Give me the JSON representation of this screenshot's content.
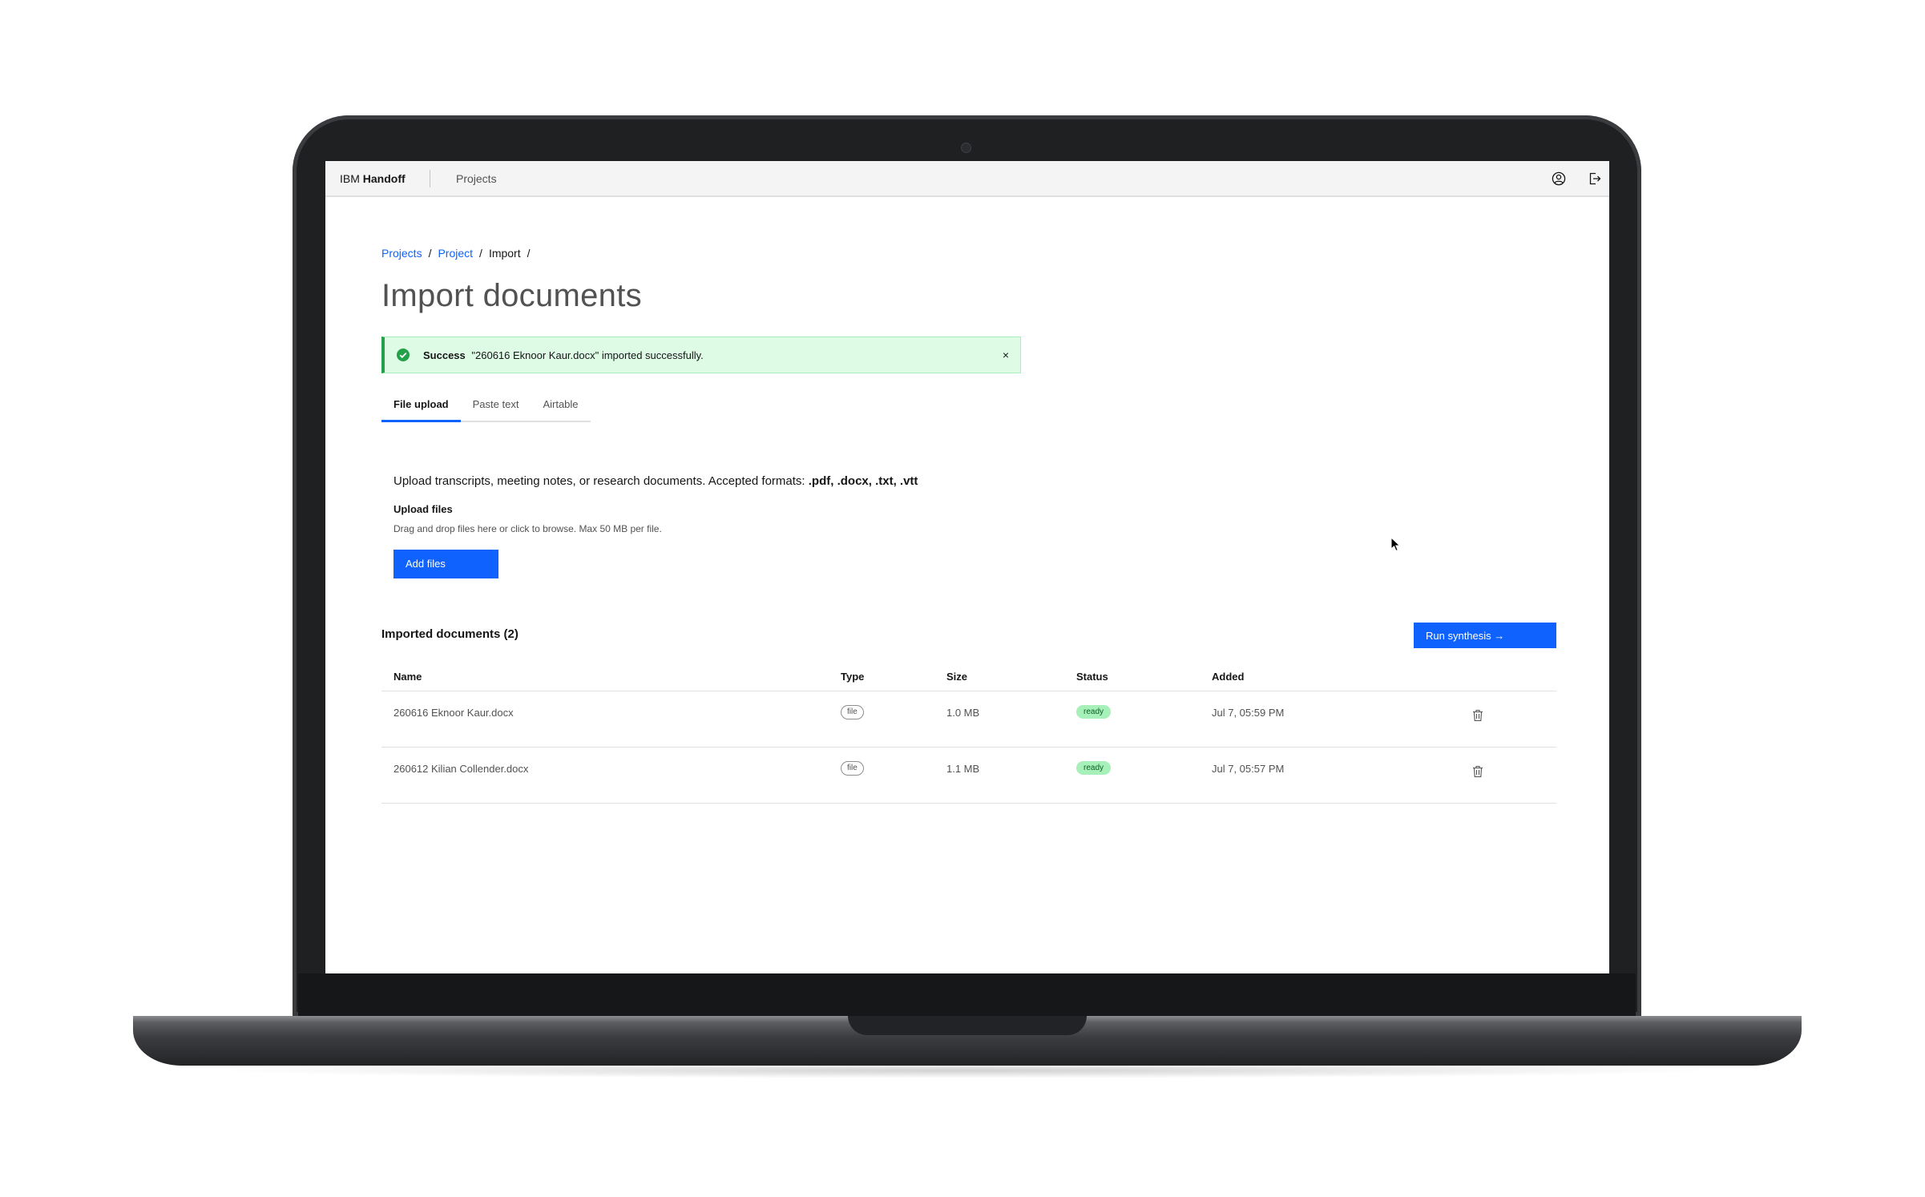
{
  "app": {
    "brand_prefix": "IBM",
    "brand_name": "Handoff",
    "nav_projects": "Projects"
  },
  "icons": {
    "user": "user-avatar-icon",
    "logout": "logout-icon",
    "success": "checkmark-filled-icon",
    "close": "close-icon",
    "delete": "trash-icon",
    "cursor": "mouse-pointer-icon"
  },
  "breadcrumb": {
    "items": [
      "Projects",
      "Project",
      "Import"
    ],
    "separator": "/"
  },
  "page": {
    "title": "Import documents"
  },
  "notification": {
    "kind": "success",
    "title": "Success",
    "message": "\"260616 Eknoor Kaur.docx\" imported successfully.",
    "close_glyph": "×"
  },
  "tabs": [
    {
      "label": "File upload",
      "active": true
    },
    {
      "label": "Paste text",
      "active": false
    },
    {
      "label": "Airtable",
      "active": false
    }
  ],
  "upload": {
    "description_prefix": "Upload transcripts, meeting notes, or research documents. Accepted formats: ",
    "formats": ".pdf, .docx, .txt, .vtt",
    "label": "Upload files",
    "helper": "Drag and drop files here or click to browse. Max 50 MB per file.",
    "button": "Add files"
  },
  "documents": {
    "title": "Imported documents (2)",
    "run_button": "Run synthesis →",
    "columns": [
      "Name",
      "Type",
      "Size",
      "Status",
      "Added"
    ],
    "rows": [
      {
        "name": "260616 Eknoor Kaur.docx",
        "type": "file",
        "size": "1.0 MB",
        "status": "ready",
        "added": "Jul 7, 05:59 PM"
      },
      {
        "name": "260612 Kilian Collender.docx",
        "type": "file",
        "size": "1.1 MB",
        "status": "ready",
        "added": "Jul 7, 05:57 PM"
      }
    ]
  },
  "colors": {
    "primary": "#0f62fe",
    "success": "#24a148",
    "success_bg": "#defbe6",
    "ready_tag_bg": "#a7f0ba"
  }
}
